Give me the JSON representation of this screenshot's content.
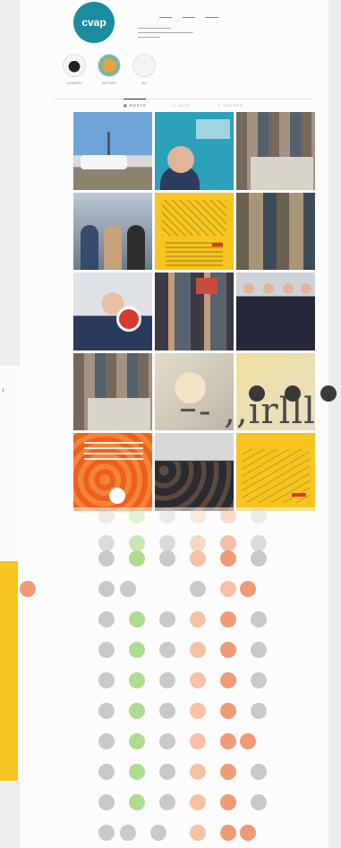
{
  "top_bar": {
    "dashes": "— — —"
  },
  "profile": {
    "logo_text": "cvap"
  },
  "highlights": [
    {
      "label": "LEADER",
      "kind": "c1"
    },
    {
      "label": "REPORT",
      "kind": "c2"
    },
    {
      "label": "JEL",
      "kind": "c3"
    }
  ],
  "tabs": [
    {
      "label": "▦ POSTS",
      "active": true
    },
    {
      "label": "▷ IGTV",
      "active": false
    },
    {
      "label": "◻ TAGGED",
      "active": false
    }
  ],
  "overlay": {
    "text": "- ,,irlll"
  },
  "left_card": {
    "nub": "‹"
  },
  "colors": {
    "gray": "#c9c9c9",
    "green": "#addc8f",
    "peach": "#f7c1a3",
    "orange": "#ef9b76",
    "brand": "#1b8ca0",
    "yellow": "#f6c51f"
  },
  "dot_rows": [
    [
      "g",
      "gr",
      "g",
      "p",
      "o",
      "g"
    ],
    [
      "g",
      "gr",
      "g",
      "p",
      "o",
      "g"
    ],
    [
      "g",
      "gr",
      "g",
      "p",
      "o",
      "g"
    ],
    [
      "g",
      "g",
      "e",
      "g",
      "p",
      "o",
      "o"
    ],
    [
      "g",
      "gr",
      "g",
      "p",
      "o",
      "g"
    ],
    [
      "g",
      "gr",
      "g",
      "p",
      "o",
      "g"
    ],
    [
      "g",
      "gr",
      "g",
      "p",
      "o",
      "g"
    ],
    [
      "g",
      "gr",
      "g",
      "p",
      "o",
      "g"
    ],
    [
      "g",
      "gr",
      "g",
      "p",
      "o",
      "o"
    ],
    [
      "g",
      "gr",
      "g",
      "p",
      "o",
      "g"
    ],
    [
      "g",
      "gr",
      "g",
      "p",
      "o",
      "g"
    ],
    [
      "g",
      "g",
      "g",
      "p",
      "o",
      "o"
    ]
  ]
}
